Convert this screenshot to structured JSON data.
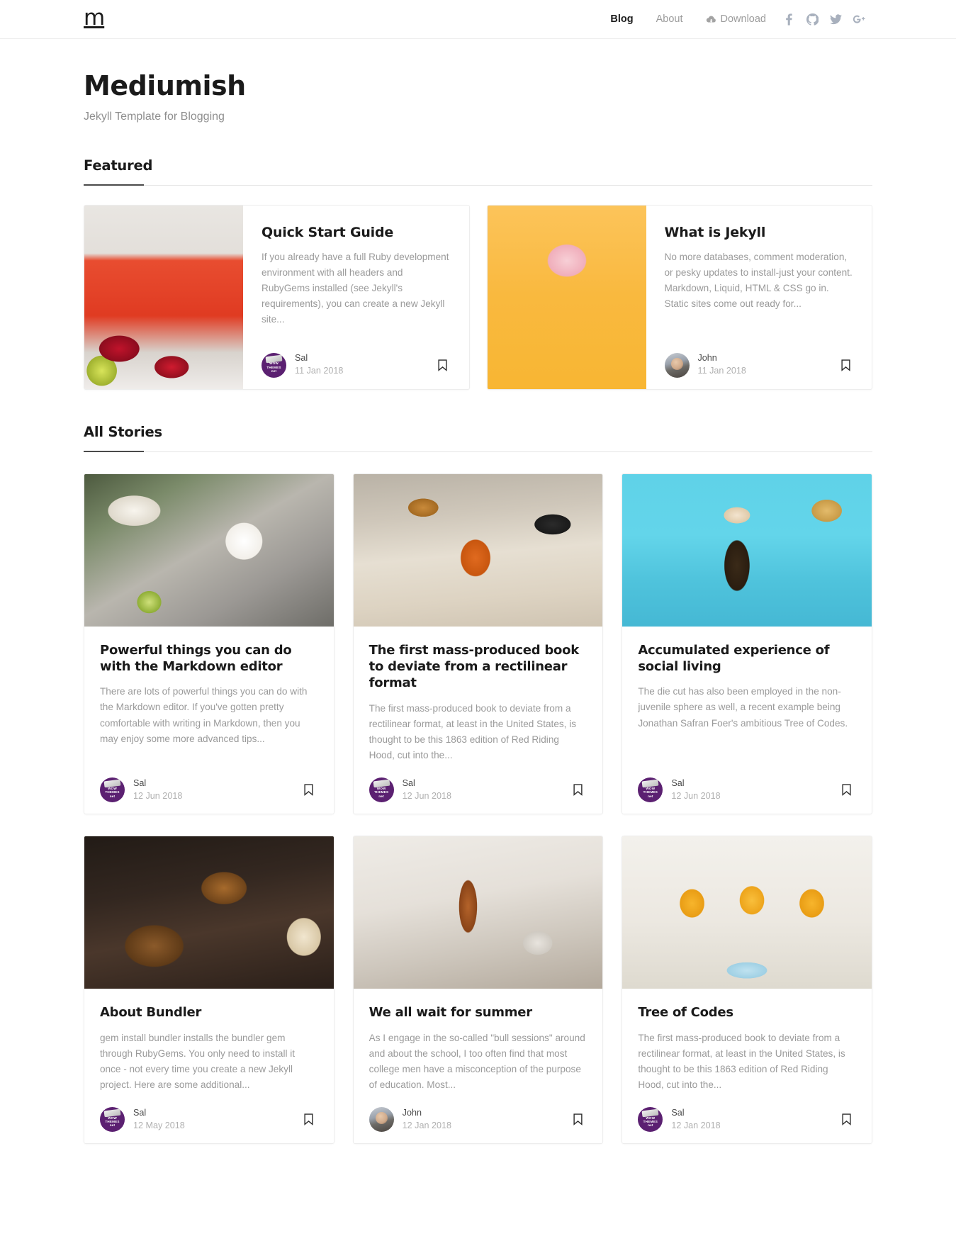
{
  "header": {
    "logo": "m",
    "nav": [
      {
        "label": "Blog",
        "name": "nav-blog",
        "active": true
      },
      {
        "label": "About",
        "name": "nav-about",
        "active": false
      },
      {
        "label": "Download",
        "name": "nav-download",
        "icon": "cloud-download-icon",
        "active": false
      }
    ],
    "social": [
      {
        "name": "facebook-icon",
        "label": "Facebook"
      },
      {
        "name": "github-icon",
        "label": "GitHub"
      },
      {
        "name": "twitter-icon",
        "label": "Twitter"
      },
      {
        "name": "google-plus-icon",
        "label": "Google Plus"
      }
    ]
  },
  "page": {
    "title": "Mediumish",
    "subtitle": "Jekyll Template for Blogging"
  },
  "sections": {
    "featured_heading": "Featured",
    "all_stories_heading": "All Stories"
  },
  "featured": [
    {
      "title": "Quick Start Guide",
      "excerpt": "If you already have a full Ruby development environment with all headers and RubyGems installed (see Jekyll's requirements), you can create a new Jekyll site...",
      "author": "Sal",
      "date": "11 Jan 2018",
      "avatar": "wow-themes-avatar",
      "image": "strawberry-drinks-photo"
    },
    {
      "title": "What is Jekyll",
      "excerpt": "No more databases, comment moderation, or pesky updates to install-just your content. Markdown, Liquid, HTML & CSS go in. Static sites come out ready for...",
      "author": "John",
      "date": "11 Jan 2018",
      "avatar": "john-avatar",
      "image": "ice-cream-cone-photo"
    }
  ],
  "stories": [
    {
      "title": "Powerful things you can do with the Markdown editor",
      "excerpt": "There are lots of powerful things you can do with the Markdown editor. If you've gotten pretty comfortable with writing in Markdown, then you may enjoy some more advanced tips...",
      "author": "Sal",
      "date": "12 Jun 2018",
      "avatar": "wow-themes-avatar",
      "image": "coffee-latte-photo"
    },
    {
      "title": "The first mass-produced book to deviate from a rectilinear format",
      "excerpt": "The first mass-produced book to deviate from a rectilinear format, at least in the United States, is thought to be this 1863 edition of Red Riding Hood, cut into the...",
      "author": "Sal",
      "date": "12 Jun 2018",
      "avatar": "wow-themes-avatar",
      "image": "cocktail-brunch-photo"
    },
    {
      "title": "Accumulated experience of social living",
      "excerpt": "The die cut has also been employed in the non-juvenile sphere as well, a recent example being Jonathan Safran Foer's ambitious Tree of Codes.",
      "author": "Sal",
      "date": "12 Jun 2018",
      "avatar": "wow-themes-avatar",
      "image": "iced-coffee-photo"
    },
    {
      "title": "About Bundler",
      "excerpt": "gem install bundler installs the bundler gem through RubyGems. You only need to install it once - not every time you create a new Jekyll project. Here are some additional...",
      "author": "Sal",
      "date": "12 May 2018",
      "avatar": "wow-themes-avatar",
      "image": "burger-photo"
    },
    {
      "title": "We all wait for summer",
      "excerpt": "As I engage in the so-called \"bull sessions\" around and about the school, I too often find that most college men have a misconception of the purpose of education. Most...",
      "author": "John",
      "date": "12 Jan 2018",
      "avatar": "john-avatar",
      "image": "whiskey-bottle-photo"
    },
    {
      "title": "Tree of Codes",
      "excerpt": "The first mass-produced book to deviate from a rectilinear format, at least in the United States, is thought to be this 1863 edition of Red Riding Hood, cut into the...",
      "author": "Sal",
      "date": "12 Jan 2018",
      "avatar": "wow-themes-avatar",
      "image": "mimosa-cocktails-photo"
    }
  ],
  "avatar_badge": {
    "line1": "WOW",
    "line2": "THEMES",
    "line3": "net"
  },
  "colors": {
    "text_dark": "#1a1a1a",
    "text_muted": "#9a9a9a",
    "border": "#ededed",
    "accent_rule": "#4a4a4a",
    "avatar_purple": "#5b2071",
    "social_icon": "#a8b0bd"
  },
  "icons": {
    "bookmark": "bookmark-icon"
  }
}
